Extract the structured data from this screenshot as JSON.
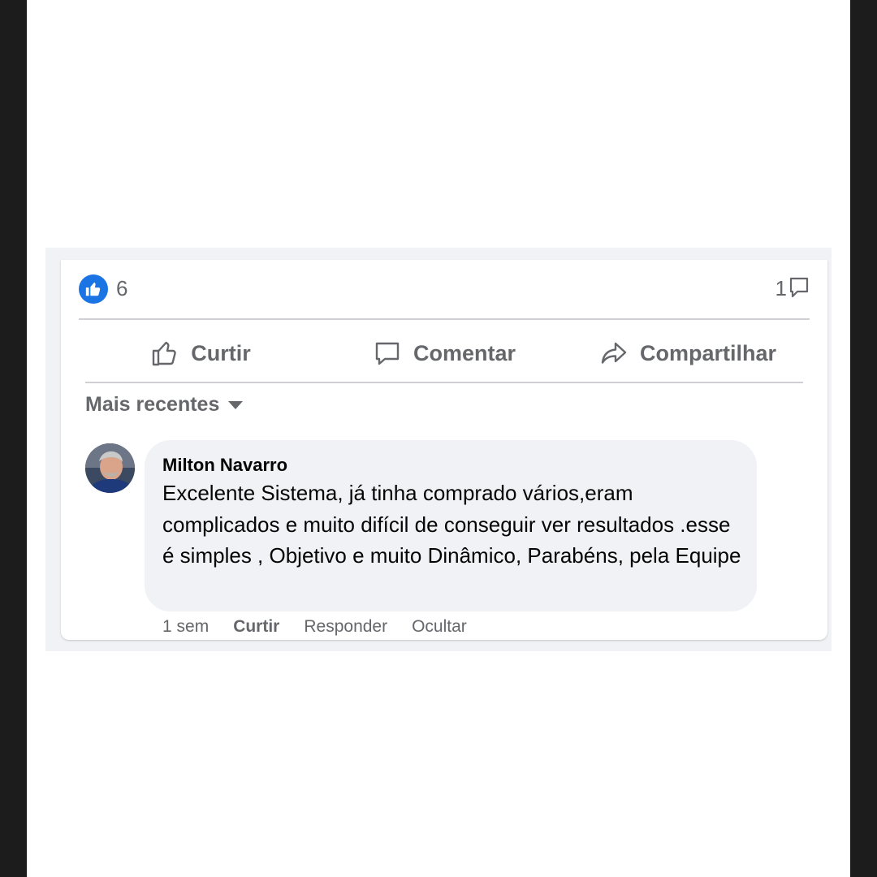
{
  "reactions": {
    "icon": "like-badge-icon",
    "count": "6",
    "accent": "#1b74e4"
  },
  "comments_count": "1",
  "actions": [
    {
      "label": "Curtir",
      "icon": "thumbs-up-outline-icon"
    },
    {
      "label": "Comentar",
      "icon": "comment-bubble-icon"
    },
    {
      "label": "Compartilhar",
      "icon": "share-arrow-icon"
    }
  ],
  "sort": {
    "label": "Mais recentes",
    "icon": "caret-down-icon"
  },
  "comment": {
    "author": "Milton Navarro",
    "text": "Excelente Sistema, já tinha comprado vários,eram complicados e muito difícil de conseguir ver resultados .esse é simples , Objetivo e muito Dinâmico, Parabéns, pela Equipe",
    "time": "1 sem",
    "like_label": "Curtir",
    "reply_label": "Responder",
    "hide_label": "Ocultar"
  }
}
